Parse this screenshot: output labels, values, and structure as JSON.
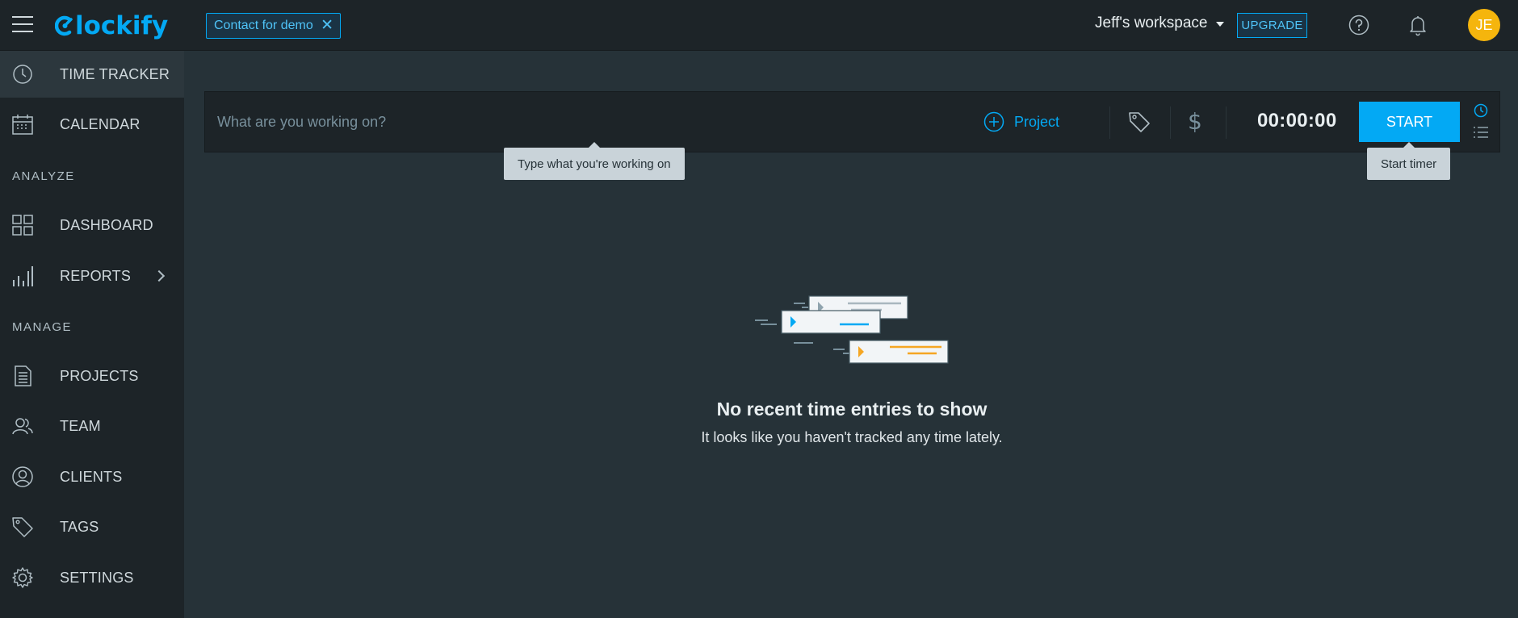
{
  "app": {
    "logo_text": "lockify",
    "brand_color": "#03a9f4"
  },
  "header": {
    "demo_chip_label": "Contact for demo",
    "demo_close": "✕",
    "workspace_name": "Jeff's workspace",
    "upgrade_label": "UPGRADE",
    "avatar_initials": "JE",
    "avatar_color": "#f5b50d"
  },
  "sidebar": {
    "items": [
      {
        "label": "TIME TRACKER",
        "icon": "clock-icon"
      },
      {
        "label": "CALENDAR",
        "icon": "calendar-icon"
      },
      {
        "label": "DASHBOARD",
        "icon": "dashboard-icon"
      },
      {
        "label": "REPORTS",
        "icon": "bar-chart-icon"
      },
      {
        "label": "PROJECTS",
        "icon": "document-icon"
      },
      {
        "label": "TEAM",
        "icon": "team-icon"
      },
      {
        "label": "CLIENTS",
        "icon": "client-icon"
      },
      {
        "label": "TAGS",
        "icon": "tag-icon"
      },
      {
        "label": "SETTINGS",
        "icon": "gear-icon"
      }
    ],
    "sections": {
      "analyze": "ANALYZE",
      "manage": "MANAGE"
    }
  },
  "tracker": {
    "input_placeholder": "What are you working on?",
    "project_label": "Project",
    "dollar_symbol": "$",
    "timer_value": "00:00:00",
    "start_label": "START",
    "tooltip_input": "Type what you're working on",
    "tooltip_start": "Start timer"
  },
  "empty_state": {
    "title": "No recent time entries to show",
    "subtitle": "It looks like you haven't tracked any time lately."
  }
}
